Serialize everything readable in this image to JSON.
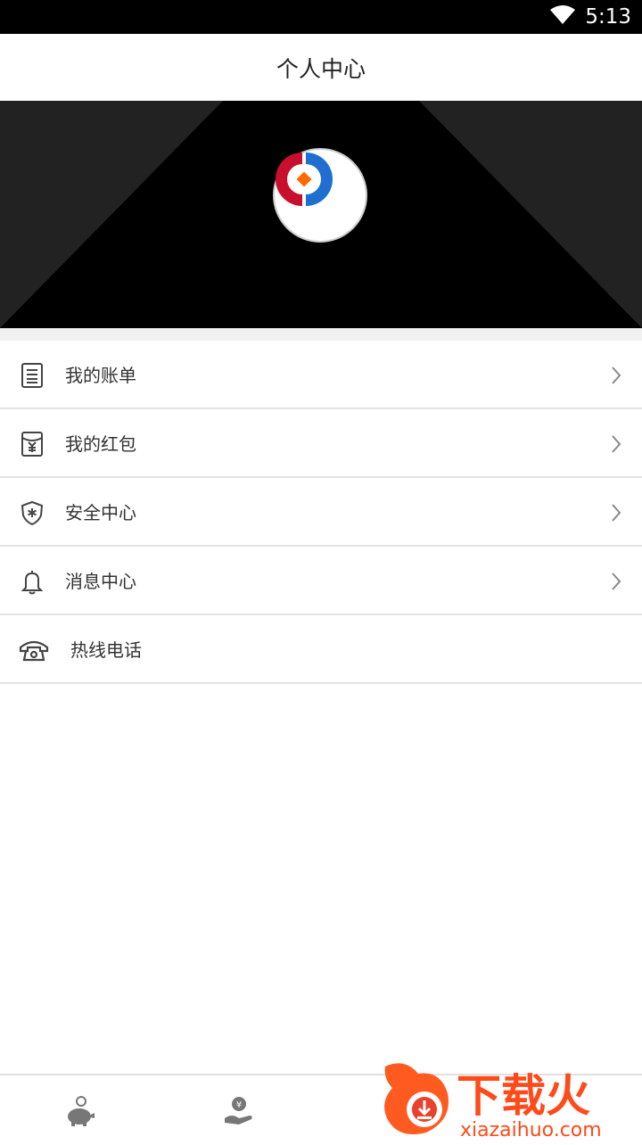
{
  "status_bar": {
    "time": "5:13",
    "wifi_icon": "wifi-icon"
  },
  "header": {
    "title": "个人中心"
  },
  "profile": {
    "avatar_icon": "app-logo-icon"
  },
  "menu": {
    "items": [
      {
        "label": "我的账单",
        "icon": "bill-icon",
        "chevron": true
      },
      {
        "label": "我的红包",
        "icon": "red-packet-icon",
        "chevron": true
      },
      {
        "label": "安全中心",
        "icon": "shield-icon",
        "chevron": true
      },
      {
        "label": "消息中心",
        "icon": "bell-icon",
        "chevron": true
      },
      {
        "label": "热线电话",
        "icon": "phone-icon",
        "chevron": false
      }
    ]
  },
  "tab_bar": {
    "tabs": [
      {
        "icon": "piggy-bank-icon"
      },
      {
        "icon": "hand-coin-icon"
      }
    ]
  },
  "watermark": {
    "brand": "下载火",
    "url": "xiazaihuo.com"
  },
  "colors": {
    "accent_red": "#c8102e",
    "accent_blue": "#1f6fd1",
    "accent_orange": "#ff6a00"
  }
}
